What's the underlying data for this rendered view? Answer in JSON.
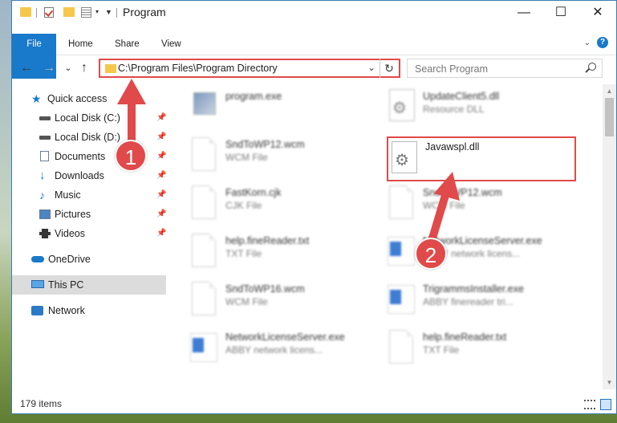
{
  "window": {
    "title": "Program",
    "controls": {
      "minimize": "—",
      "maximize": "☐",
      "close": "✕"
    }
  },
  "ribbon": {
    "tabs": [
      "File",
      "Home",
      "Share",
      "View"
    ],
    "help": "?"
  },
  "navbar": {
    "back": "←",
    "forward": "→",
    "recent": "⌄",
    "up": "↑",
    "address": "C:\\Program Files\\Program Directory",
    "refresh": "↻",
    "search_placeholder": "Search Program"
  },
  "sidebar": {
    "items": [
      {
        "label": "Quick access",
        "icon": "star-icon",
        "pinned": false
      },
      {
        "label": "Local Disk (C:)",
        "icon": "disk-icon",
        "pinned": true
      },
      {
        "label": "Local Disk (D:)",
        "icon": "disk-icon",
        "pinned": true
      },
      {
        "label": "Documents",
        "icon": "documents-icon",
        "pinned": true
      },
      {
        "label": "Downloads",
        "icon": "downloads-icon",
        "pinned": true
      },
      {
        "label": "Music",
        "icon": "music-icon",
        "pinned": true
      },
      {
        "label": "Pictures",
        "icon": "pictures-icon",
        "pinned": true
      },
      {
        "label": "Videos",
        "icon": "videos-icon",
        "pinned": true
      },
      {
        "label": "OneDrive",
        "icon": "onedrive-icon",
        "pinned": false
      },
      {
        "label": "This PC",
        "icon": "this-pc-icon",
        "pinned": false,
        "selected": true
      },
      {
        "label": "Network",
        "icon": "network-icon",
        "pinned": false
      }
    ]
  },
  "files": [
    {
      "name": "program.exe",
      "type": "",
      "icon": "exe-icon"
    },
    {
      "name": "UpdateClient5.dll",
      "type": "Resource DLL",
      "icon": "dll-icon"
    },
    {
      "name": "SndToWP12.wcm",
      "type": "WCM File",
      "icon": "file-icon"
    },
    {
      "name": "Javawspl.dll",
      "type": "",
      "icon": "dll-icon",
      "highlighted": true
    },
    {
      "name": "FastKorn.cjk",
      "type": "CJK File",
      "icon": "file-icon"
    },
    {
      "name": "SndToWP12.wcm",
      "type": "WCM File",
      "icon": "file-icon"
    },
    {
      "name": "help.fineReader.txt",
      "type": "TXT File",
      "icon": "file-icon"
    },
    {
      "name": "NetworkLicenseServer.exe",
      "type": "ABBY network licens...",
      "icon": "app-icon"
    },
    {
      "name": "SndToWP16.wcm",
      "type": "WCM File",
      "icon": "file-icon"
    },
    {
      "name": "TrigrammsInstaller.exe",
      "type": "ABBY finereader tri...",
      "icon": "app-icon"
    },
    {
      "name": "NetworkLicenseServer.exe",
      "type": "ABBY network licens...",
      "icon": "app-icon"
    },
    {
      "name": "help.fineReader.txt",
      "type": "TXT File",
      "icon": "file-icon"
    }
  ],
  "status": {
    "count": "179 items"
  },
  "annotations": {
    "step1": "1",
    "step2": "2",
    "color": "#e04a4a"
  }
}
